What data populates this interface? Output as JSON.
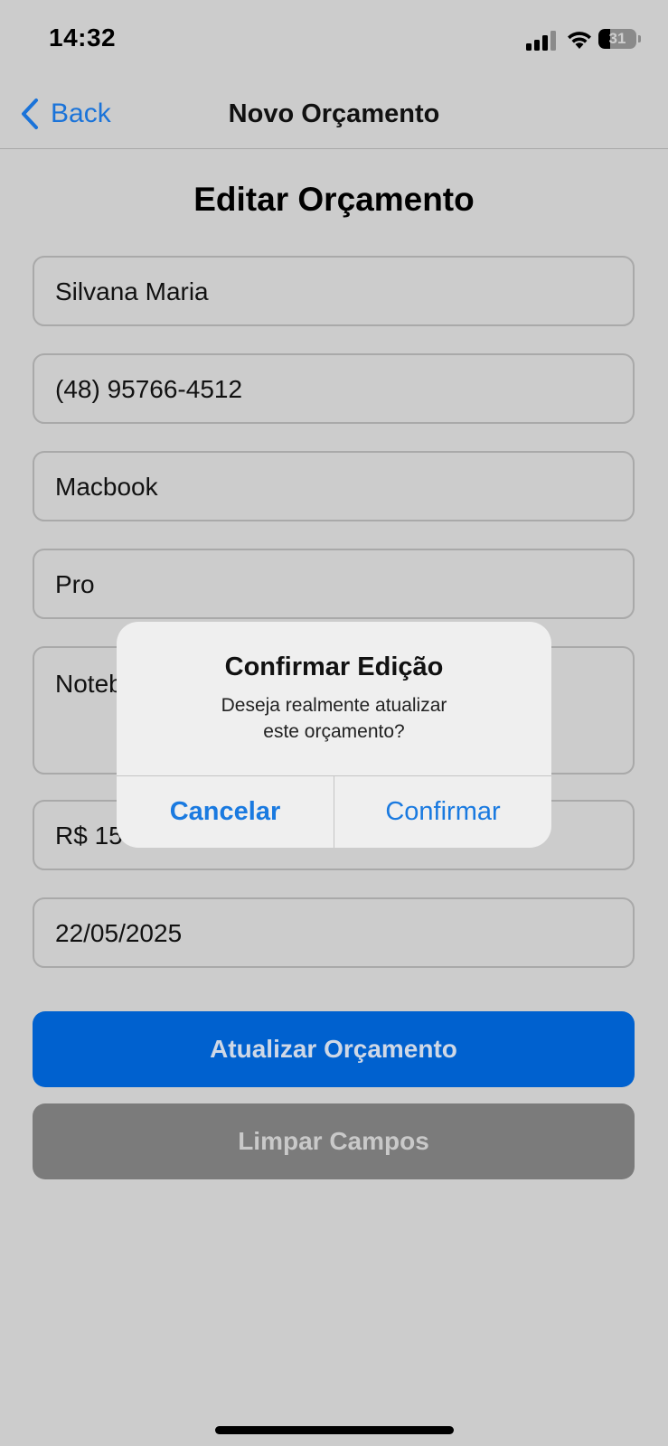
{
  "status_bar": {
    "time": "14:32",
    "battery": "31",
    "battery_level": 0.31
  },
  "nav": {
    "back_label": "Back",
    "title": "Novo Orçamento"
  },
  "page": {
    "title": "Editar Orçamento"
  },
  "form": {
    "name": "Silvana Maria",
    "phone": "(48) 95766-4512",
    "brand": "Macbook",
    "model": "Pro",
    "description": "Notebook",
    "price": "R$ 1500,00",
    "date": "22/05/2025"
  },
  "buttons": {
    "update": "Atualizar Orçamento",
    "clear": "Limpar Campos"
  },
  "alert": {
    "title": "Confirmar Edição",
    "message_line1": "Deseja realmente atualizar",
    "message_line2": "este orçamento?",
    "cancel": "Cancelar",
    "confirm": "Confirmar"
  },
  "colors": {
    "accent": "#1a73d9",
    "primary_button": "#0061cf",
    "secondary_button": "#7b7b7b",
    "background": "#cccccc"
  }
}
